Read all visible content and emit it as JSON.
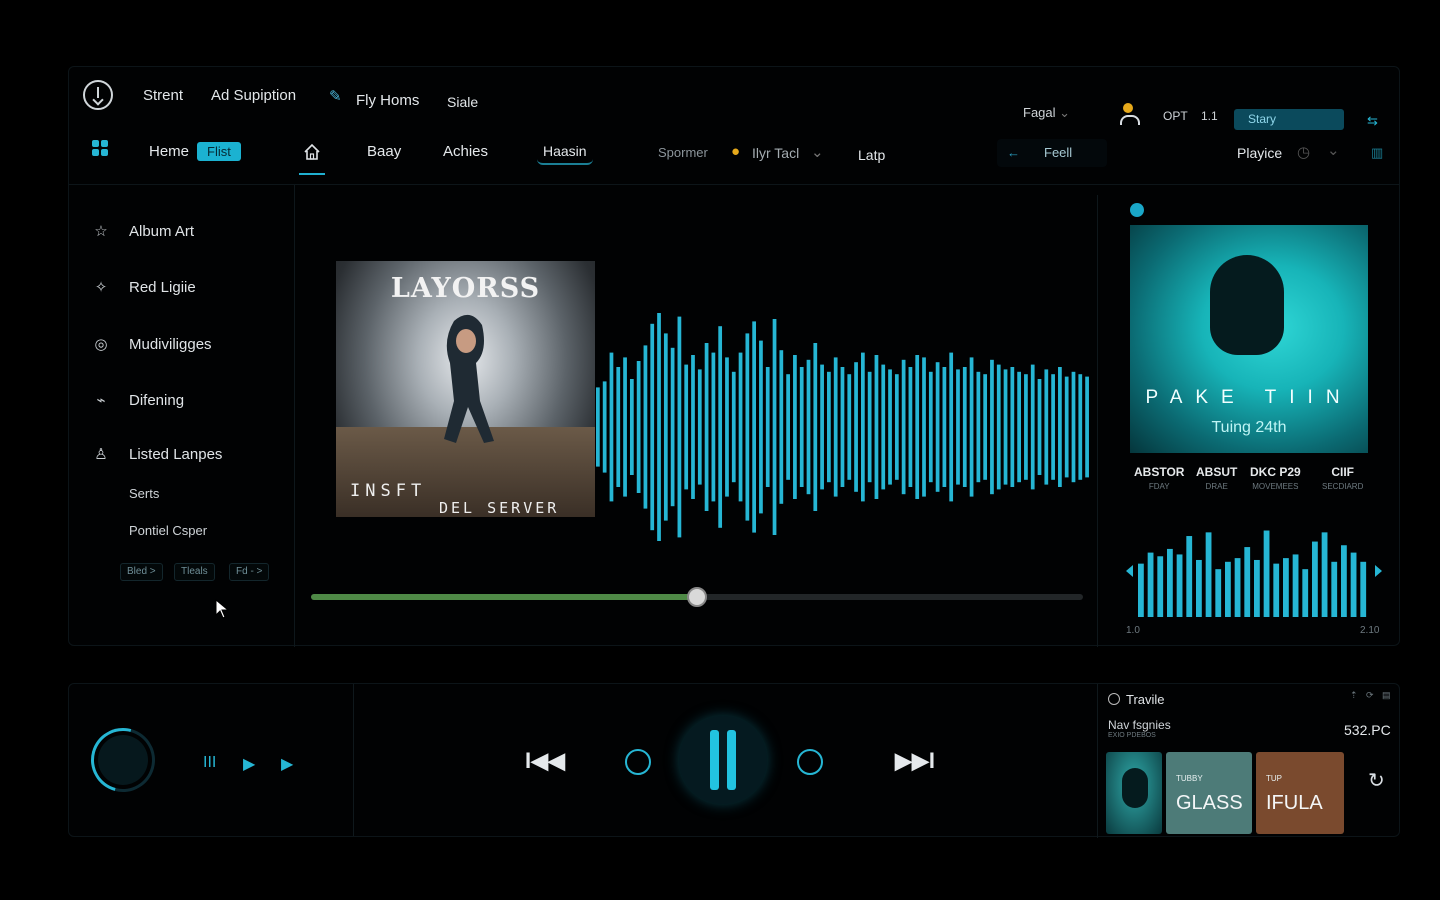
{
  "top_menu": [
    "Strent",
    "Ad Supiption",
    "Fly Homs",
    "Siale"
  ],
  "top_right": {
    "lang": "Fagal",
    "opt": "OPT",
    "opt_val": "1.1",
    "story": "Stary",
    "end": "⇆"
  },
  "nav": {
    "home": "Heme",
    "badge": "Flist",
    "tabs": [
      "Baay",
      "Achies",
      "Haasin"
    ],
    "sponsor": "Spormer",
    "select": "Ilyr Tacl",
    "lap": "Latp",
    "search": "Feell",
    "playlist": "Playice"
  },
  "sidebar": {
    "items": [
      {
        "icon": "☆",
        "label": "Album Art"
      },
      {
        "icon": "✧",
        "label": "Red Ligiie"
      },
      {
        "icon": "◎",
        "label": "Mudiviligges"
      },
      {
        "icon": "⌁",
        "label": "Difening"
      },
      {
        "icon": "♙",
        "label": "Listed Lanpes"
      }
    ],
    "subs": [
      "Serts",
      "Pontiel Csper"
    ],
    "chips": [
      "Bled >",
      "Tleals",
      "Fd - >"
    ]
  },
  "main": {
    "album": {
      "title": "LAYORSS",
      "line1": "INSFT",
      "line2": "DEL SERVER"
    },
    "progress": 0.5
  },
  "right": {
    "cover": {
      "title": "PAKE TIIN",
      "subtitle": "Tuing 24th"
    },
    "meta": [
      {
        "k": "ABSTOR",
        "v": "FDAY"
      },
      {
        "k": "ABSUT",
        "v": "DRAE"
      },
      {
        "k": "DKC P29",
        "v": "MOVEMEES"
      },
      {
        "k": "CIIF",
        "v": "SECDIARD"
      }
    ],
    "eq_values": [
      58,
      70,
      66,
      74,
      68,
      88,
      62,
      92,
      52,
      60,
      64,
      76,
      62,
      94,
      58,
      64,
      68,
      52,
      82,
      92,
      60,
      78,
      70,
      60
    ],
    "eq_left": "1.0",
    "eq_right": "2.10"
  },
  "waveform_values": [
    0.33,
    0.38,
    0.62,
    0.5,
    0.58,
    0.4,
    0.55,
    0.68,
    0.86,
    0.95,
    0.78,
    0.66,
    0.92,
    0.52,
    0.6,
    0.48,
    0.7,
    0.62,
    0.84,
    0.58,
    0.46,
    0.62,
    0.78,
    0.88,
    0.72,
    0.5,
    0.9,
    0.64,
    0.44,
    0.6,
    0.5,
    0.56,
    0.7,
    0.52,
    0.46,
    0.58,
    0.5,
    0.44,
    0.54,
    0.62,
    0.46,
    0.6,
    0.52,
    0.48,
    0.44,
    0.56,
    0.5,
    0.6,
    0.58,
    0.46,
    0.54,
    0.5,
    0.62,
    0.48,
    0.5,
    0.58,
    0.46,
    0.44,
    0.56,
    0.52,
    0.48,
    0.5,
    0.46,
    0.44,
    0.52,
    0.4,
    0.48,
    0.44,
    0.5,
    0.42,
    0.46,
    0.44,
    0.42
  ],
  "player": {
    "mini_icons": [
      "III",
      "▶",
      "▶"
    ],
    "prev": "I◀◀",
    "next": "▶▶I"
  },
  "queue": {
    "title": "Travile",
    "subtitle": "Nav fsgnies",
    "subtitle2": "EXIO PDEBOS",
    "price": "532.PC",
    "tiles": [
      {
        "label": "TUBBY",
        "big": "GLASS",
        "color": "#4d7b78"
      },
      {
        "label": "TUP",
        "big": "IFULA",
        "color": "#7a4a2e"
      }
    ]
  },
  "colors": {
    "accent": "#26b6d4",
    "progress": "#4f8a47"
  }
}
